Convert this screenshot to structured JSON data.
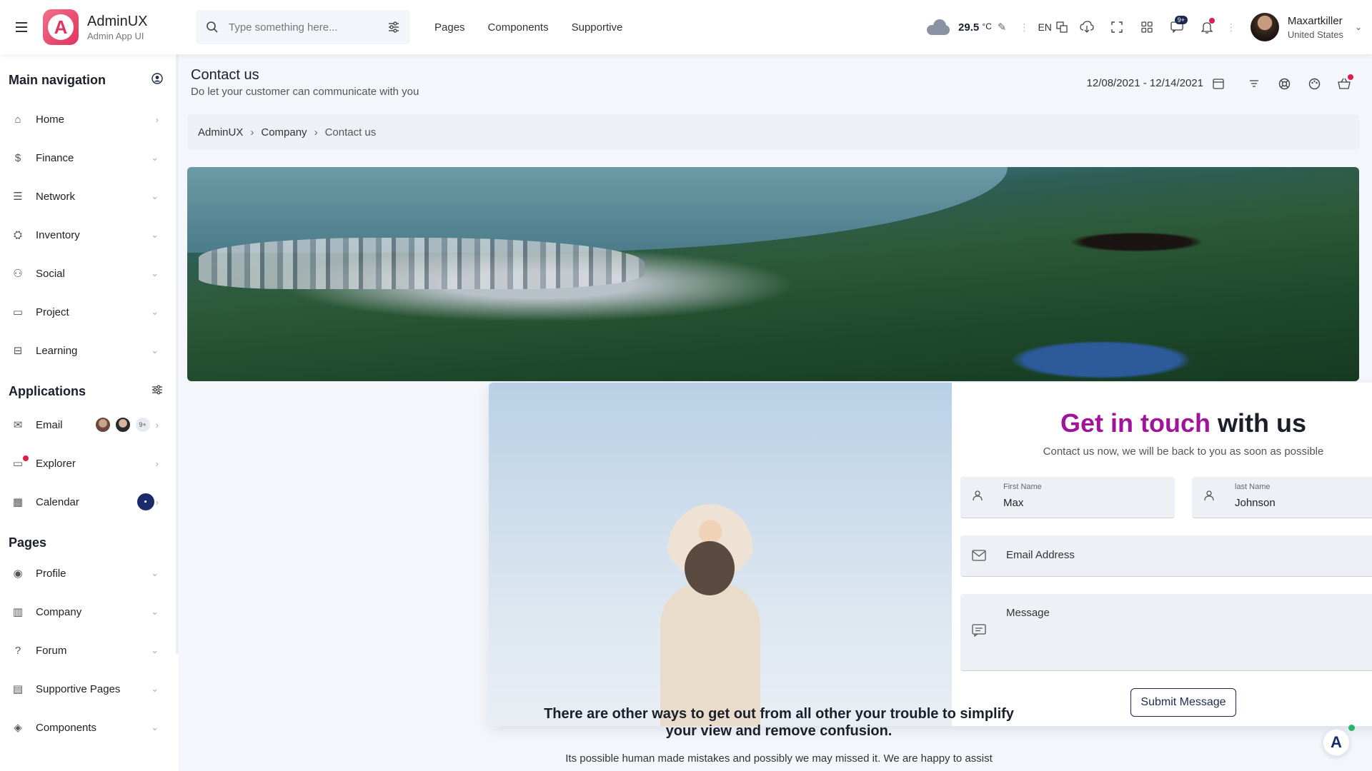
{
  "header": {
    "brand_title": "AdminUX",
    "brand_subtitle": "Admin App UI",
    "search_placeholder": "Type something here...",
    "nav": [
      "Pages",
      "Components",
      "Supportive"
    ],
    "weather_temp": "29.5",
    "weather_unit": "°C",
    "language": "EN",
    "message_badge": "9+",
    "user_name": "Maxartkiller",
    "user_country": "United States"
  },
  "sidebar": {
    "main_nav_title": "Main navigation",
    "main_items": [
      "Home",
      "Finance",
      "Network",
      "Inventory",
      "Social",
      "Project",
      "Learning"
    ],
    "applications_title": "Applications",
    "app_items": [
      "Email",
      "Explorer",
      "Calendar"
    ],
    "email_more_badge": "9+",
    "pages_title": "Pages",
    "page_items": [
      "Profile",
      "Company",
      "Forum",
      "Supportive Pages",
      "Components"
    ]
  },
  "page": {
    "title": "Contact us",
    "subtitle": "Do let your customer can communicate with you",
    "date_range": "12/08/2021 - 12/14/2021",
    "breadcrumb": [
      "AdminUX",
      "Company",
      "Contact us"
    ]
  },
  "form": {
    "title_accent": "Get in touch",
    "title_rest": " with us",
    "subtitle": "Contact us now, we will be back to you as soon as possible",
    "first_name_label": "First Name",
    "first_name_value": "Max",
    "last_name_label": "last Name",
    "last_name_value": "Johnson",
    "email_placeholder": "Email Address",
    "message_placeholder": "Message",
    "submit_label": "Submit Message"
  },
  "bottom": {
    "title": "There are other ways to get out from all other your trouble to simplify your view and remove confusion.",
    "text": "Its possible human made mistakes and possibly we may missed it. We are happy to assist"
  },
  "colors": {
    "accent": "#a0139a",
    "primary": "#1b2a4e",
    "notification": "#e31b4c"
  }
}
